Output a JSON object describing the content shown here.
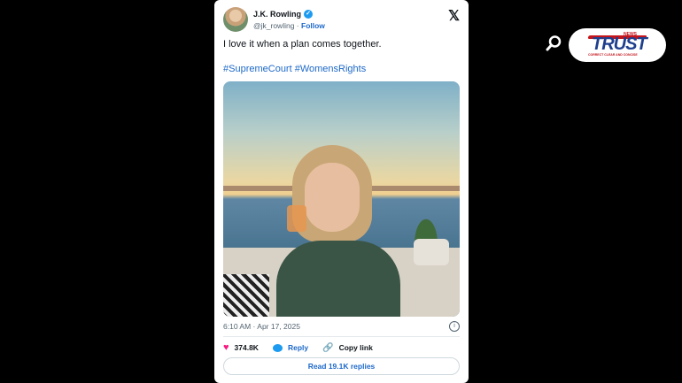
{
  "tweet": {
    "author_name": "J.K. Rowling",
    "handle": "@jk_rowling",
    "separator": " · ",
    "follow_label": "Follow",
    "text": "I love it when a plan comes together.",
    "hashtags": [
      "#SupremeCourt",
      "#WomensRights"
    ],
    "timestamp": "6:10 AM · Apr 17, 2025",
    "likes": "374.8K",
    "reply_label": "Reply",
    "copy_link_label": "Copy link",
    "read_replies_label": "Read 19.1K replies",
    "x_logo": "𝕏",
    "info_icon": "i"
  },
  "brand": {
    "logo_text": "TRUST",
    "logo_tag": "NEWS",
    "logo_sub": "CORRECT CLEAR AND CONCISE",
    "brand_blue": "#1f3f8e",
    "brand_red": "#c4151c"
  },
  "icons": {
    "search": "search-icon",
    "heart": "heart-icon",
    "reply": "reply-icon",
    "link": "link-icon"
  }
}
